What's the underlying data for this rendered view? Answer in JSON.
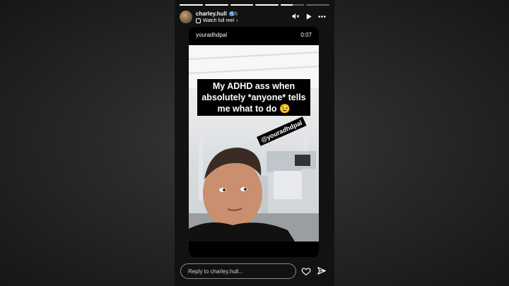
{
  "story": {
    "username": "charley.hull",
    "time_ago": "1h",
    "watch_full_reel": "Watch full reel",
    "progress_segments": [
      1,
      1,
      1,
      1,
      0.5,
      0
    ],
    "icons": [
      "mute-icon",
      "play-icon",
      "more-icon"
    ]
  },
  "reel_card": {
    "username": "youradhdpal",
    "duration": "0:07",
    "caption": "My ADHD ass when absolutely *anyone* tells me what to do 😉",
    "tag": "@youradhdpal"
  },
  "footer": {
    "reply_placeholder": "Reply to charley.hull...",
    "icons": [
      "heart-icon",
      "send-icon"
    ]
  },
  "colors": {
    "verified": "#3897f0",
    "background": "#121212"
  }
}
